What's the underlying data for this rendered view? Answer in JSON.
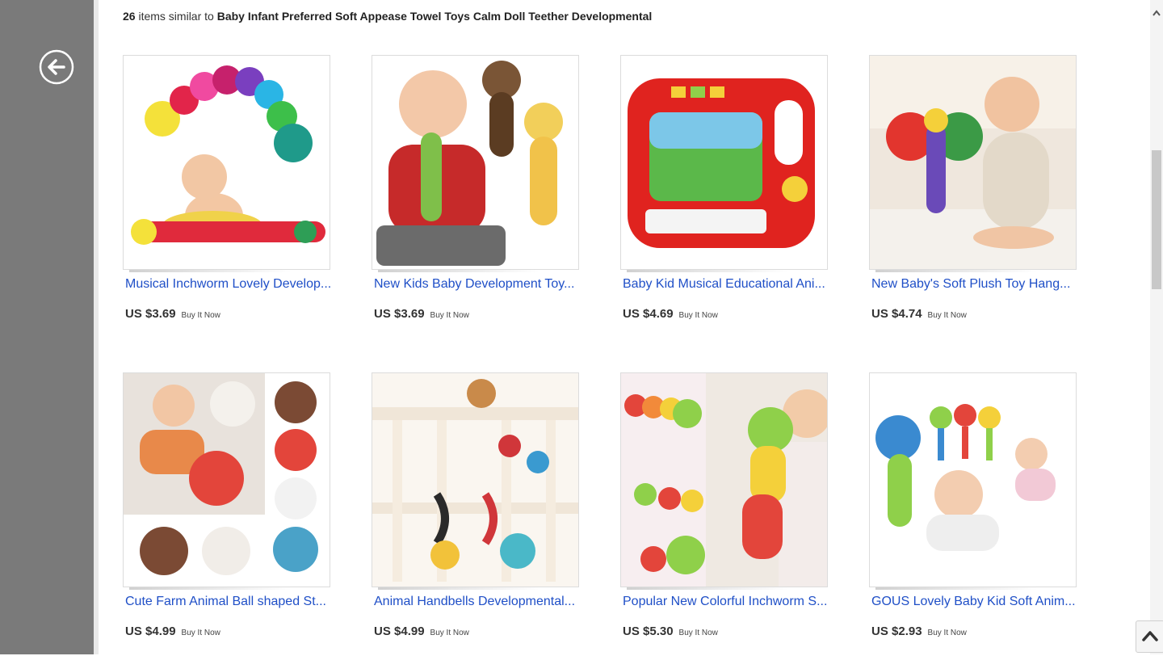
{
  "header": {
    "count": "26",
    "middle_text": " items similar to ",
    "query": "Baby Infant Preferred Soft Appease Towel Toys Calm Doll Teether Developmental"
  },
  "items": [
    {
      "title": "Musical Inchworm Lovely Develop...",
      "price": "US $3.69",
      "buy": "Buy It Now",
      "image_icon": "inchworm-baby-image"
    },
    {
      "title": "New Kids Baby Development Toy...",
      "price": "US $3.69",
      "buy": "Buy It Now",
      "image_icon": "baby-rattles-image"
    },
    {
      "title": "Baby Kid Musical Educational Ani...",
      "price": "US $4.69",
      "buy": "Buy It Now",
      "image_icon": "musical-piano-image"
    },
    {
      "title": "New Baby's Soft Plush Toy Hang...",
      "price": "US $4.74",
      "buy": "Buy It Now",
      "image_icon": "plush-butterfly-image"
    },
    {
      "title": "Cute Farm Animal Ball shaped St...",
      "price": "US $4.99",
      "buy": "Buy It Now",
      "image_icon": "animal-balls-image"
    },
    {
      "title": "Animal Handbells Developmental...",
      "price": "US $4.99",
      "buy": "Buy It Now",
      "image_icon": "crib-handbells-image"
    },
    {
      "title": "Popular New Colorful Inchworm S...",
      "price": "US $5.30",
      "buy": "Buy It Now",
      "image_icon": "colorful-inchworm-image"
    },
    {
      "title": "GOUS Lovely Baby Kid Soft Anim...",
      "price": "US $2.93",
      "buy": "Buy It Now",
      "image_icon": "animal-rattles-image"
    }
  ],
  "colors": {
    "sidebar": "#7a7a7a",
    "link": "#1f4fc7",
    "price": "#333333"
  },
  "icons": {
    "back": "back-arrow-icon",
    "scroll_up": "chevron-up-icon",
    "scroll_top": "scroll-to-top-icon"
  }
}
